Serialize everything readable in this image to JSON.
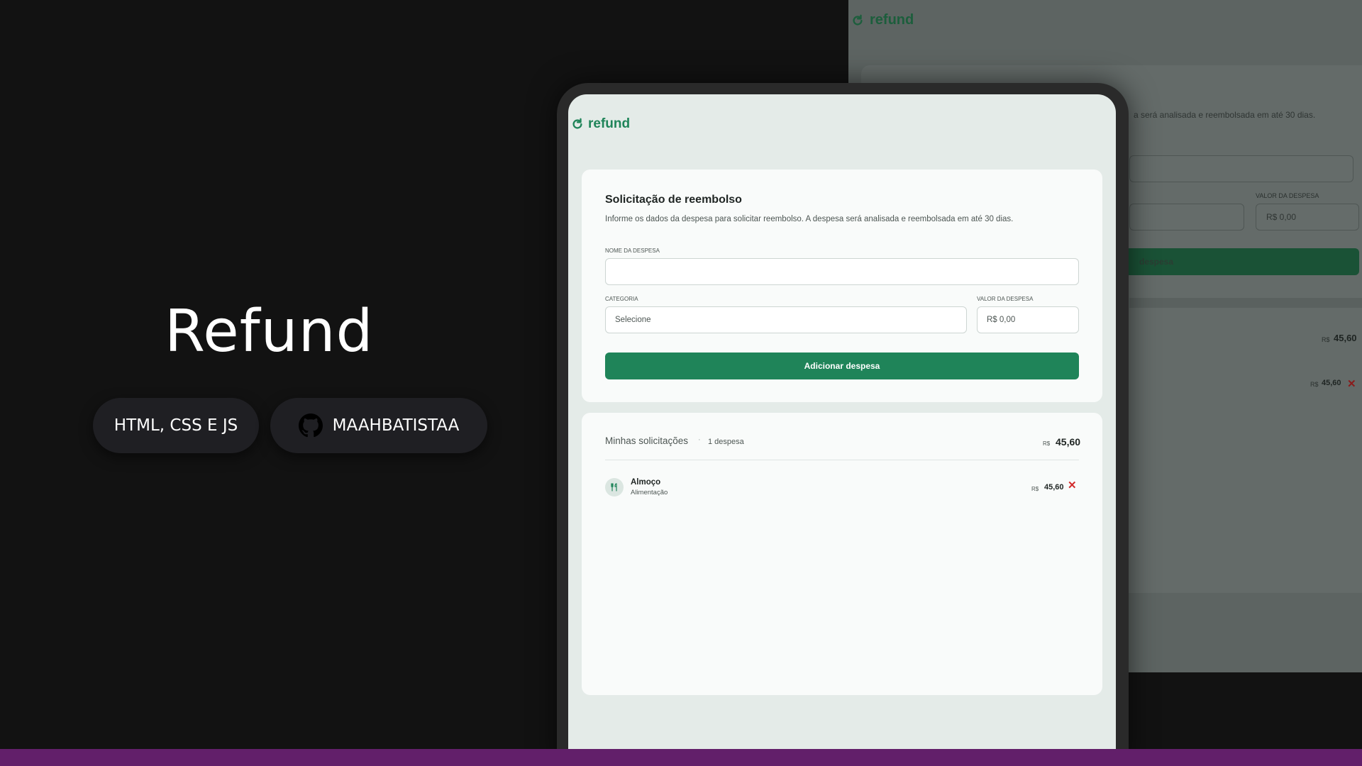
{
  "hero": {
    "title": "Refund",
    "tech_label": "HTML, CSS E JS",
    "github_label": "MAAHBATISTAA"
  },
  "app": {
    "logo_text": "refund",
    "form": {
      "title": "Solicitação de reembolso",
      "subtitle": "Informe os dados da despesa para solicitar reembolso. A despesa será analisada e reembolsada em até 30 dias.",
      "name_label": "NOME DA DESPESA",
      "name_value": "",
      "category_label": "CATEGORIA",
      "category_placeholder": "Selecione",
      "amount_label": "VALOR DA DESPESA",
      "amount_placeholder": "R$ 0,00",
      "submit_label": "Adicionar despesa"
    },
    "list": {
      "title": "Minhas solicitações",
      "separator": "·",
      "count_label": "1 despesa",
      "currency": "R$",
      "total": "45,60",
      "items": [
        {
          "name": "Almoço",
          "category": "Alimentação",
          "currency": "R$",
          "value": "45,60",
          "icon": "utensils-icon",
          "remove": "✕"
        }
      ]
    }
  },
  "background_shot": {
    "logo_text": "refund",
    "subtitle_fragment": "a será analisada e reembolsada em até 30 dias.",
    "amount_label": "VALOR DA DESPESA",
    "amount_placeholder": "R$ 0,00",
    "button_fragment": "despesa",
    "total_currency": "R$",
    "total_value": "45,60",
    "item_currency": "R$",
    "item_value": "45,60",
    "remove": "✕"
  },
  "colors": {
    "accent": "#1f8459",
    "danger": "#d22b2b",
    "bottom_bar": "#621f6a",
    "background": "#121212"
  }
}
